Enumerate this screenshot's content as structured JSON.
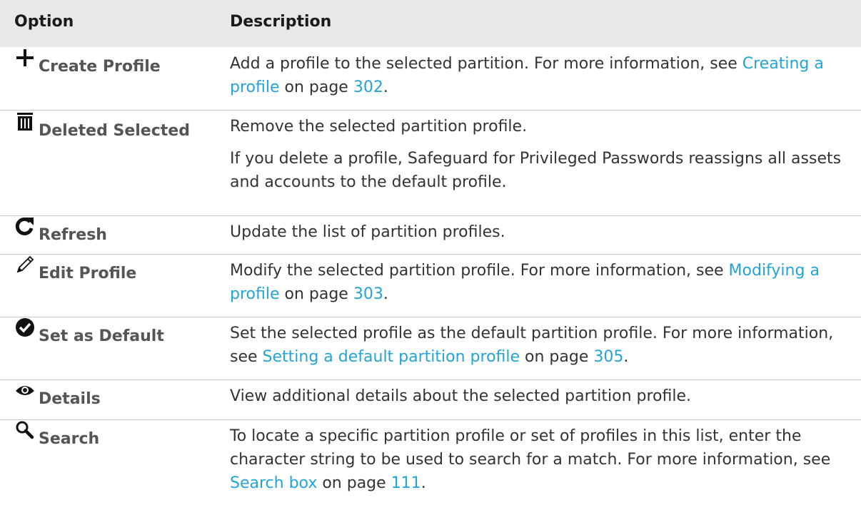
{
  "header": {
    "option": "Option",
    "description": "Description"
  },
  "rows": [
    {
      "icon": "plus-icon",
      "label": "Create Profile",
      "desc_pre": "Add a profile to the selected partition. For more information, see ",
      "link": "Creating a profile",
      "desc_mid": " on page ",
      "page": "302",
      "desc_post": "."
    },
    {
      "icon": "trash-icon",
      "label": "Deleted Selected",
      "desc_p1": "Remove the selected partition profile.",
      "desc_p2": "If you delete a profile, Safeguard for Privileged Passwords reassigns all assets and accounts to the default profile."
    },
    {
      "icon": "refresh-icon",
      "label": "Refresh",
      "desc_p1": "Update the list of partition profiles."
    },
    {
      "icon": "pencil-icon",
      "label": "Edit Profile",
      "desc_pre": "Modify the selected partition profile. For more information, see ",
      "link": "Modifying a profile",
      "desc_mid": " on page ",
      "page": "303",
      "desc_post": "."
    },
    {
      "icon": "checkmark-circle-icon",
      "label": "Set as Default",
      "desc_pre": "Set the selected profile as the default partition profile. For more information, see ",
      "link": "Setting a default partition profile",
      "desc_mid": " on page ",
      "page": "305",
      "desc_post": "."
    },
    {
      "icon": "eye-icon",
      "label": "Details",
      "desc_p1": "View additional details about the selected partition profile."
    },
    {
      "icon": "search-icon",
      "label": "Search",
      "desc_pre": "To locate a specific partition profile or set of profiles in this list, enter the character string to be used to search for a match. For more information, see ",
      "link": "Search box",
      "desc_mid": " on page ",
      "page": "111",
      "desc_post": "."
    }
  ]
}
